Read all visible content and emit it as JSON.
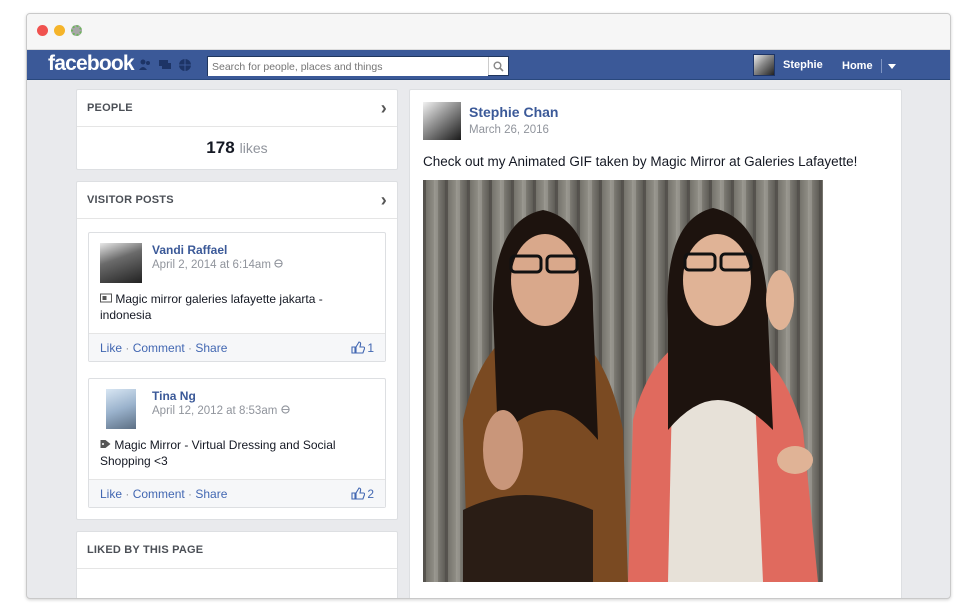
{
  "browser": {
    "buttons": [
      "close",
      "minimize",
      "zoom"
    ]
  },
  "topbar": {
    "logo": "facebook",
    "jewels": [
      "friends-icon",
      "messages-icon",
      "notifications-icon"
    ],
    "search_placeholder": "Search for people, places and things",
    "user_name": "Stephie",
    "home_label": "Home"
  },
  "people": {
    "title": "PEOPLE",
    "likes_count": "178",
    "likes_label": "likes"
  },
  "visitor_posts": {
    "title": "VISITOR POSTS",
    "posts": [
      {
        "name": "Vandi Raffael",
        "date": "April 2, 2014 at 6:14am",
        "text": "Magic mirror galeries lafayette jakarta - indonesia",
        "like": "Like",
        "comment": "Comment",
        "share": "Share",
        "like_count": "1"
      },
      {
        "name": "Tina Ng",
        "date": "April 12, 2012 at 8:53am",
        "text": "Magic Mirror - Virtual Dressing and Social Shopping <3",
        "like": "Like",
        "comment": "Comment",
        "share": "Share",
        "like_count": "2"
      }
    ]
  },
  "liked_by": {
    "title": "LIKED BY THIS PAGE"
  },
  "feed_post": {
    "name": "Stephie Chan",
    "date": "March 26, 2016",
    "text": "Check out my Animated GIF taken by Magic Mirror at Galeries Lafayette!"
  },
  "separator": " · "
}
